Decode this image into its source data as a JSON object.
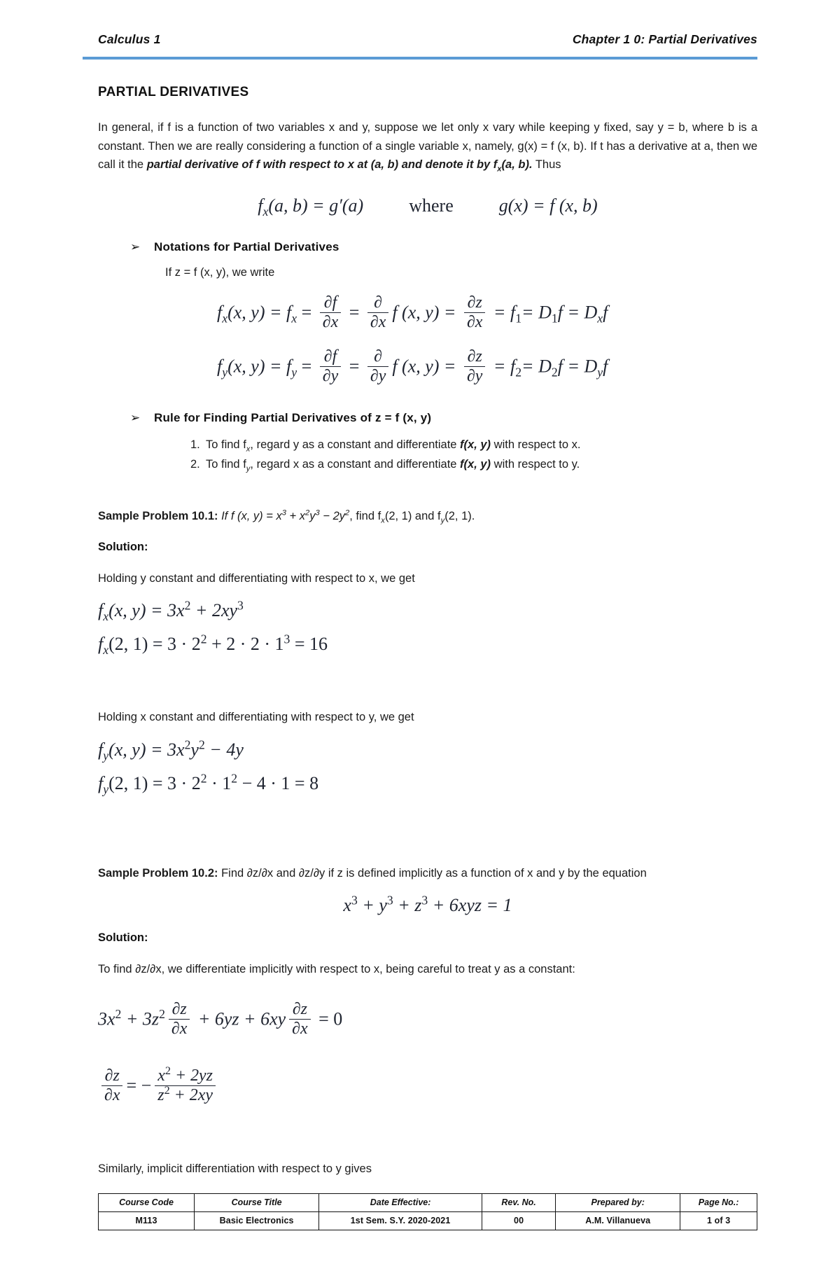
{
  "header": {
    "left": "Calculus 1",
    "right": "Chapter 1 0: Partial Derivatives"
  },
  "section": {
    "title": "PARTIAL DERIVATIVES"
  },
  "intro": {
    "part1": "In general, if f is a function of two variables x and y, suppose we let only x vary while keeping y fixed, say y = b, where b is a constant. Then we are really considering a function of a single variable x, namely, g(x) = f (x, b). If t has a derivative at a, then we call it the ",
    "bold1": "partial derivative of f with respect to x at (a, b) and denote it by f",
    "bold_sub": "x",
    "bold2": "(a, b).",
    "part2": " Thus"
  },
  "main_equation": {
    "lhs": "f",
    "lhs_sub": "x",
    "lhs_args": "(a, b) = g′(a)",
    "connector": "where",
    "rhs": "g(x) = f (x, b)"
  },
  "notations": {
    "bullet_glyph": "➢",
    "heading": "Notations for Partial Derivatives",
    "lead_in": "If z = f (x, y), we write",
    "eq1": {
      "t1": "f",
      "t1_sub": "x",
      "t2": "(x, y) = f",
      "t2_sub": "x",
      "t3": "=",
      "f1n": "∂f",
      "f1d": "∂x",
      "t4": "=",
      "f2n": "∂",
      "f2d": "∂x",
      "t5": "f (x, y) =",
      "f3n": "∂z",
      "f3d": "∂x",
      "t6": "= f",
      "t6_sub": "1",
      "t7": "= D",
      "t7_sub": "1",
      "t8": "f = D",
      "t8_sub": "x",
      "t9": "f"
    },
    "eq2": {
      "t1": "f",
      "t1_sub": "y",
      "t2": "(x, y) = f",
      "t2_sub": "y",
      "t3": "=",
      "f1n": "∂f",
      "f1d": "∂y",
      "t4": "=",
      "f2n": "∂",
      "f2d": "∂y",
      "t5": "f (x, y) =",
      "f3n": "∂z",
      "f3d": "∂y",
      "t6": "= f",
      "t6_sub": "2",
      "t7": "= D",
      "t7_sub": "2",
      "t8": "f = D",
      "t8_sub": "y",
      "t9": "f"
    }
  },
  "rules": {
    "bullet_glyph": "➢",
    "heading": "Rule for Finding Partial Derivatives of z = f (x, y)",
    "items": [
      {
        "num": "1.",
        "pre": "To find f",
        "sub": "x",
        "mid": ", regard y as a constant and differentiate ",
        "bold": "f(x, y)",
        "post": " with respect to x."
      },
      {
        "num": "2.",
        "pre": "To find f",
        "sub": "y",
        "mid": ", regard x as a constant and differentiate ",
        "bold": "f(x, y)",
        "post": " with respect to y."
      }
    ]
  },
  "problem1": {
    "label": "Sample Problem 10.1:",
    "statement_a": " If f (x, y) = x",
    "sup1": "3",
    "statement_b": " + x",
    "sup2": "2",
    "statement_c": "y",
    "sup3": "3",
    "statement_d": " − 2y",
    "sup4": "2",
    "statement_e": ", find f",
    "sub1": "x",
    "statement_f": "(2, 1) and f",
    "sub2": "y",
    "statement_g": "(2, 1).",
    "solution_label": "Solution:",
    "line_x": "Holding y constant and differentiating with respect to x, we get",
    "eq_x1": {
      "lhs": "f",
      "sub": "x",
      "rest": "(x, y) = 3x",
      "sup1": "2",
      "rest2": " + 2xy",
      "sup2": "3"
    },
    "eq_x2": {
      "lhs": "f",
      "sub": "x",
      "rest": "(2, 1) = 3 · 2",
      "sup1": "2",
      "rest2": " + 2 · 2 · 1",
      "sup2": "3",
      "rest3": " = 16"
    },
    "line_y": "Holding x constant and differentiating with respect to y, we get",
    "eq_y1": {
      "lhs": "f",
      "sub": "y",
      "rest": "(x, y) = 3x",
      "sup1": "2",
      "rest2": "y",
      "sup2": "2",
      "rest3": " − 4y"
    },
    "eq_y2": {
      "lhs": "f",
      "sub": "y",
      "rest": "(2, 1) = 3 · 2",
      "sup1": "2",
      "rest2": " · 1",
      "sup2": "2",
      "rest3": " − 4 · 1 = 8"
    }
  },
  "problem2": {
    "label": "Sample Problem  10.2:",
    "statement": " Find ∂z/∂x and ∂z/∂y if z is defined implicitly as a function of x and y by the equation",
    "equation": {
      "a": "x",
      "a_sup": "3",
      "b": " + y",
      "b_sup": "3",
      "c": " + z",
      "c_sup": "3",
      "d": " + 6xyz = 1"
    },
    "solution_label": "Solution:",
    "line_intro": "To find ∂z/∂x, we differentiate implicitly with respect to x, being careful to treat y as a constant:",
    "eq1": {
      "a": "3x",
      "a_sup": "2",
      "b": " + 3z",
      "b_sup": "2",
      "f1n": "∂z",
      "f1d": "∂x",
      "c": " + 6yz + 6xy",
      "f2n": "∂z",
      "f2d": "∂x",
      "d": " = 0"
    },
    "eq2": {
      "ln": "∂z",
      "ld": "∂x",
      "eqsign": "= −",
      "rn_a": "x",
      "rn_sup": "2",
      "rn_b": " + 2yz",
      "rd_a": "z",
      "rd_sup": "2",
      "rd_b": " + 2xy"
    },
    "closing": "Similarly, implicit differentiation with respect to y gives"
  },
  "footer": {
    "columns": [
      "Course Code",
      "Course Title",
      "Date Effective:",
      "Rev. No.",
      "Prepared by:",
      "Page No.:"
    ],
    "values": [
      "M113",
      "Basic Electronics",
      "1st Sem. S.Y. 2020-2021",
      "00",
      "A.M. Villanueva",
      "1 of 3"
    ]
  },
  "colors": {
    "header_rule": "#5b9bd5",
    "math_ink": "#1f2430",
    "text": "#1c1c1c"
  }
}
